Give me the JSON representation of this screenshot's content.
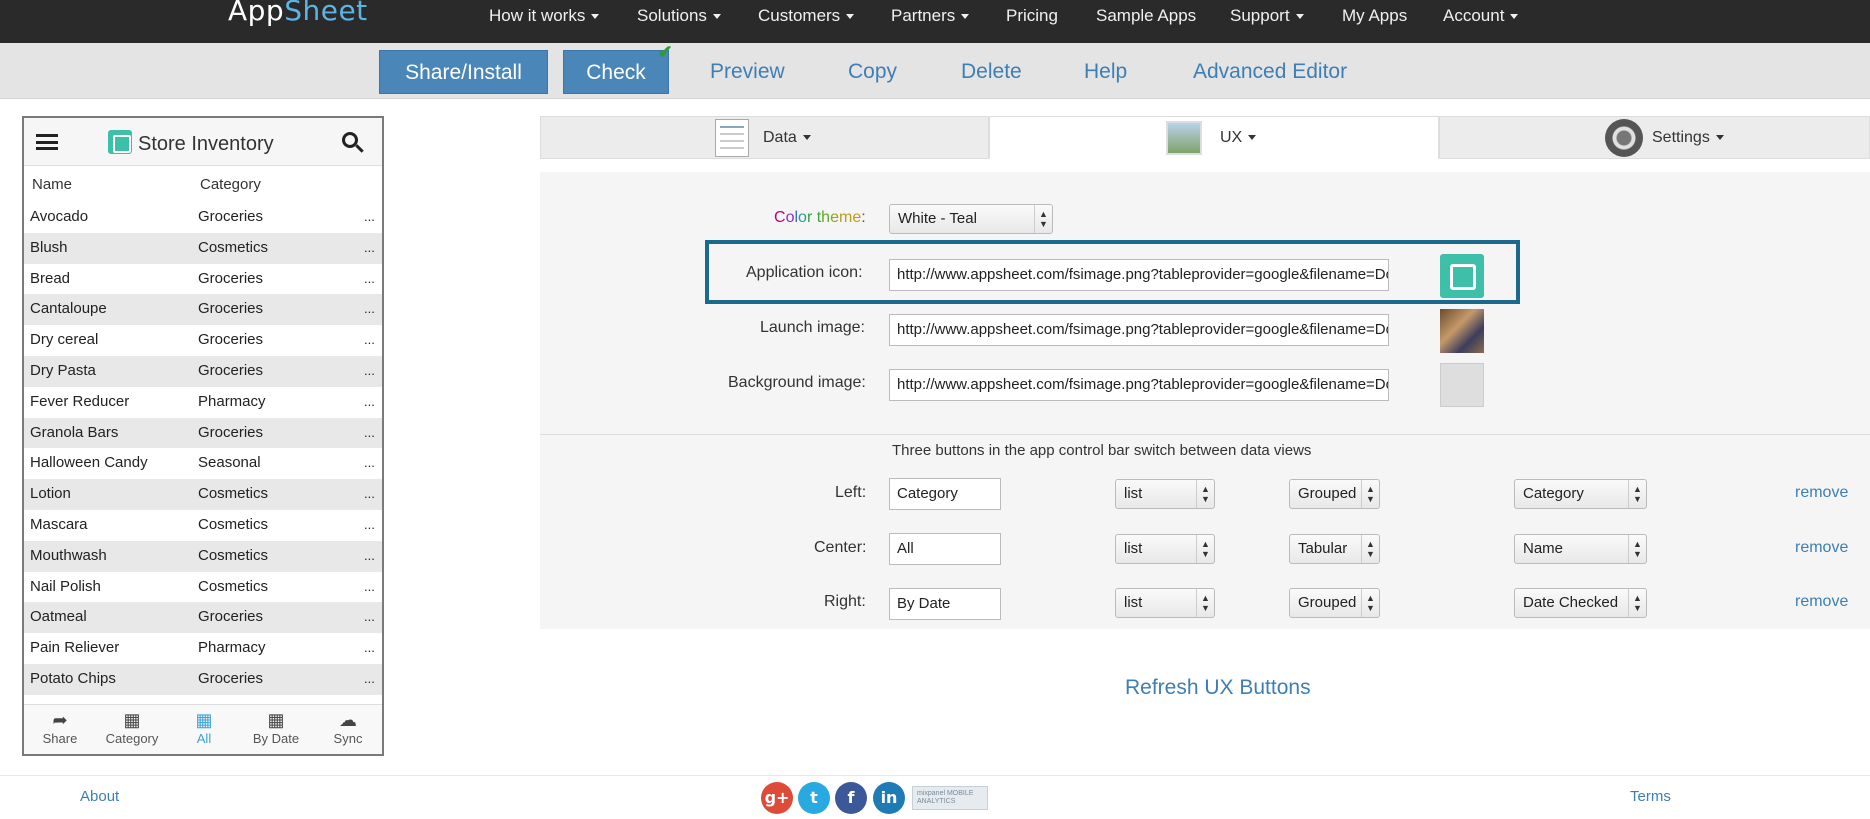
{
  "topnav": {
    "logo_app": "App",
    "logo_sheet": "Sheet",
    "items": [
      "How it works",
      "Solutions",
      "Customers",
      "Partners",
      "Pricing",
      "Sample Apps",
      "Support",
      "My Apps",
      "Account"
    ]
  },
  "toolbar": {
    "share": "Share/Install",
    "check": "Check",
    "preview": "Preview",
    "copy": "Copy",
    "delete": "Delete",
    "help": "Help",
    "advanced": "Advanced Editor"
  },
  "phone": {
    "title": "Store Inventory",
    "col_name": "Name",
    "col_category": "Category",
    "rows": [
      {
        "name": "Avocado",
        "category": "Groceries"
      },
      {
        "name": "Blush",
        "category": "Cosmetics"
      },
      {
        "name": "Bread",
        "category": "Groceries"
      },
      {
        "name": "Cantaloupe",
        "category": "Groceries"
      },
      {
        "name": "Dry cereal",
        "category": "Groceries"
      },
      {
        "name": "Dry Pasta",
        "category": "Groceries"
      },
      {
        "name": "Fever Reducer",
        "category": "Pharmacy"
      },
      {
        "name": "Granola Bars",
        "category": "Groceries"
      },
      {
        "name": "Halloween Candy",
        "category": "Seasonal"
      },
      {
        "name": "Lotion",
        "category": "Cosmetics"
      },
      {
        "name": "Mascara",
        "category": "Cosmetics"
      },
      {
        "name": "Mouthwash",
        "category": "Cosmetics"
      },
      {
        "name": "Nail Polish",
        "category": "Cosmetics"
      },
      {
        "name": "Oatmeal",
        "category": "Groceries"
      },
      {
        "name": "Pain Reliever",
        "category": "Pharmacy"
      },
      {
        "name": "Potato Chips",
        "category": "Groceries"
      }
    ],
    "row_more": "...",
    "footer": [
      "Share",
      "Category",
      "All",
      "By Date",
      "Sync"
    ]
  },
  "tabs": {
    "data": "Data",
    "ux": "UX",
    "settings": "Settings"
  },
  "form": {
    "color_theme_label": [
      "C",
      "o",
      "l",
      "o",
      "r",
      " ",
      "t",
      "h",
      "e",
      "m",
      "e",
      ":"
    ],
    "color_theme_value": "White - Teal",
    "app_icon_label": "Application icon:",
    "app_icon_value": "http://www.appsheet.com/fsimage.png?tableprovider=google&filename=Doc",
    "launch_label": "Launch image:",
    "launch_value": "http://www.appsheet.com/fsimage.png?tableprovider=google&filename=Doc",
    "bg_label": "Background image:",
    "bg_value": "http://www.appsheet.com/fsimage.png?tableprovider=google&filename=Doc",
    "info": "Three buttons in the app control bar switch between data views",
    "buttons": [
      {
        "label": "Left:",
        "name": "Category",
        "view": "list",
        "mode": "Grouped",
        "column": "Category",
        "remove": "remove"
      },
      {
        "label": "Center:",
        "name": "All",
        "view": "list",
        "mode": "Tabular",
        "column": "Name",
        "remove": "remove"
      },
      {
        "label": "Right:",
        "name": "By Date",
        "view": "list",
        "mode": "Grouped",
        "column": "Date Checked",
        "remove": "remove"
      }
    ],
    "refresh": "Refresh UX Buttons"
  },
  "footer": {
    "about": "About",
    "terms": "Terms",
    "social": [
      {
        "glyph": "g+",
        "color": "#dd4b39"
      },
      {
        "glyph": "t",
        "color": "#29a9e1"
      },
      {
        "glyph": "f",
        "color": "#3b5998"
      },
      {
        "glyph": "in",
        "color": "#1f7bb6"
      }
    ],
    "mixpanel": "mixpanel MOBILE ANALYTICS"
  },
  "colors": {
    "accent": "#4a86b8",
    "highlight_border": "#1b6a8e",
    "link": "#3d7fb5"
  }
}
